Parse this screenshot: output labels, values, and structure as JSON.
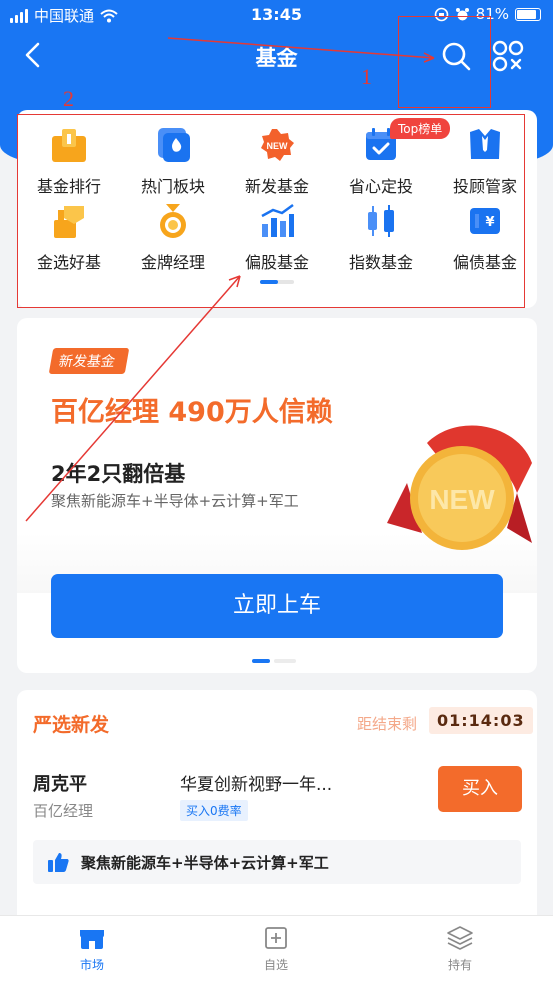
{
  "status_bar": {
    "carrier": "中国联通",
    "time": "13:45",
    "battery": "81%"
  },
  "nav": {
    "title": "基金",
    "back_icon": "chevron-left-icon",
    "search_icon": "search-icon",
    "scan_icon": "scan-icon"
  },
  "annotations": {
    "label_1": "1",
    "label_2": "2",
    "color": "#e53935"
  },
  "menu": {
    "badge": "Top榜单",
    "items": [
      {
        "label": "基金排行",
        "icon": "ranking-icon"
      },
      {
        "label": "热门板块",
        "icon": "hot-sector-icon"
      },
      {
        "label": "新发基金",
        "icon": "new-fund-icon"
      },
      {
        "label": "省心定投",
        "icon": "auto-invest-icon"
      },
      {
        "label": "投顾管家",
        "icon": "advisor-icon"
      },
      {
        "label": "金选好基",
        "icon": "gold-select-icon"
      },
      {
        "label": "金牌经理",
        "icon": "gold-manager-icon"
      },
      {
        "label": "偏股基金",
        "icon": "equity-fund-icon"
      },
      {
        "label": "指数基金",
        "icon": "index-fund-icon"
      },
      {
        "label": "偏债基金",
        "icon": "bond-fund-icon"
      }
    ],
    "new_text": "NEW"
  },
  "promo": {
    "tag": "新发基金",
    "headline": "百亿经理  490万人信赖",
    "sub": "2年2只翻倍基",
    "desc": "聚焦新能源车+半导体+云计算+军工",
    "medal_text": "NEW",
    "button": "立即上车"
  },
  "select": {
    "title": "严选新发",
    "countdown_label": "距结束剩",
    "countdown": "01:14:03",
    "manager_name": "周克平",
    "manager_title": "百亿经理",
    "fund_name": "华夏创新视野一年...",
    "fund_tag": "买入0费率",
    "buy_button": "买入",
    "highlight": "聚焦新能源车+半导体+云计算+军工"
  },
  "tab_bar": {
    "items": [
      {
        "label": "市场",
        "icon": "market-icon",
        "active": true
      },
      {
        "label": "自选",
        "icon": "watchlist-icon",
        "active": false
      },
      {
        "label": "持有",
        "icon": "holdings-icon",
        "active": false
      }
    ]
  },
  "colors": {
    "brand_blue": "#1976f3",
    "accent_orange": "#f36b2b",
    "annotation_red": "#e53935"
  }
}
